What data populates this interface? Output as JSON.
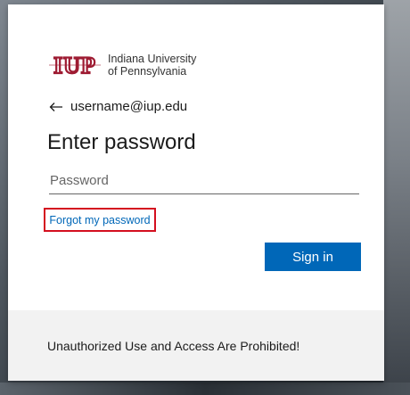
{
  "logo": {
    "name": "iup-logo",
    "mark_text": "IUP",
    "line1": "Indiana University",
    "line2": "of Pennsylvania",
    "brand_color": "#9e1b32"
  },
  "identity": {
    "back_icon": "arrow-left-icon",
    "email": "username@iup.edu"
  },
  "title": "Enter password",
  "password": {
    "placeholder": "Password",
    "value": ""
  },
  "forgot_link": {
    "label": "Forgot my password",
    "highlight_color": "#d40f1f"
  },
  "signin": {
    "label": "Sign in",
    "color": "#0067b8"
  },
  "footer": {
    "text": "Unauthorized Use and Access Are Prohibited!"
  }
}
